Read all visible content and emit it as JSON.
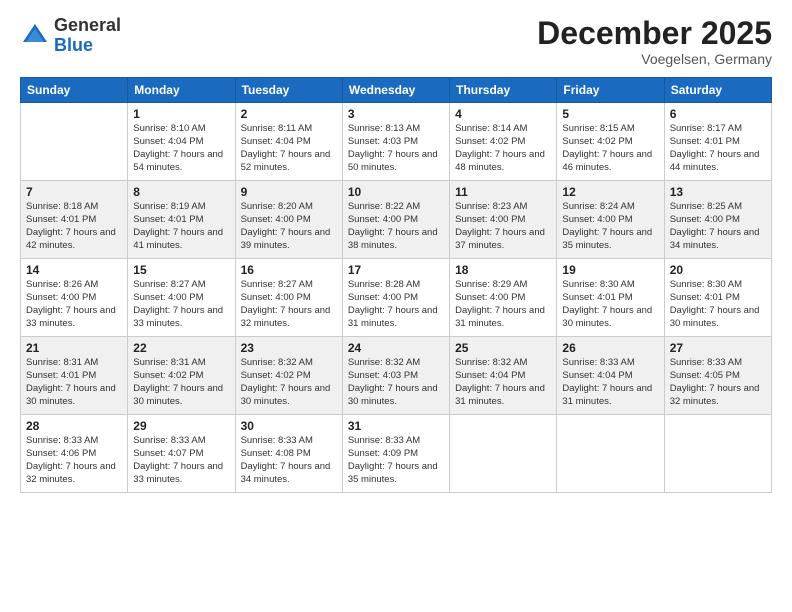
{
  "header": {
    "logo_general": "General",
    "logo_blue": "Blue",
    "month_title": "December 2025",
    "location": "Voegelsen, Germany"
  },
  "weekdays": [
    "Sunday",
    "Monday",
    "Tuesday",
    "Wednesday",
    "Thursday",
    "Friday",
    "Saturday"
  ],
  "rows": [
    {
      "shaded": false,
      "cells": [
        {
          "empty": true
        },
        {
          "day": "1",
          "sunrise": "8:10 AM",
          "sunset": "4:04 PM",
          "daylight": "7 hours and 54 minutes."
        },
        {
          "day": "2",
          "sunrise": "8:11 AM",
          "sunset": "4:04 PM",
          "daylight": "7 hours and 52 minutes."
        },
        {
          "day": "3",
          "sunrise": "8:13 AM",
          "sunset": "4:03 PM",
          "daylight": "7 hours and 50 minutes."
        },
        {
          "day": "4",
          "sunrise": "8:14 AM",
          "sunset": "4:02 PM",
          "daylight": "7 hours and 48 minutes."
        },
        {
          "day": "5",
          "sunrise": "8:15 AM",
          "sunset": "4:02 PM",
          "daylight": "7 hours and 46 minutes."
        },
        {
          "day": "6",
          "sunrise": "8:17 AM",
          "sunset": "4:01 PM",
          "daylight": "7 hours and 44 minutes."
        }
      ]
    },
    {
      "shaded": true,
      "cells": [
        {
          "day": "7",
          "sunrise": "8:18 AM",
          "sunset": "4:01 PM",
          "daylight": "7 hours and 42 minutes."
        },
        {
          "day": "8",
          "sunrise": "8:19 AM",
          "sunset": "4:01 PM",
          "daylight": "7 hours and 41 minutes."
        },
        {
          "day": "9",
          "sunrise": "8:20 AM",
          "sunset": "4:00 PM",
          "daylight": "7 hours and 39 minutes."
        },
        {
          "day": "10",
          "sunrise": "8:22 AM",
          "sunset": "4:00 PM",
          "daylight": "7 hours and 38 minutes."
        },
        {
          "day": "11",
          "sunrise": "8:23 AM",
          "sunset": "4:00 PM",
          "daylight": "7 hours and 37 minutes."
        },
        {
          "day": "12",
          "sunrise": "8:24 AM",
          "sunset": "4:00 PM",
          "daylight": "7 hours and 35 minutes."
        },
        {
          "day": "13",
          "sunrise": "8:25 AM",
          "sunset": "4:00 PM",
          "daylight": "7 hours and 34 minutes."
        }
      ]
    },
    {
      "shaded": false,
      "cells": [
        {
          "day": "14",
          "sunrise": "8:26 AM",
          "sunset": "4:00 PM",
          "daylight": "7 hours and 33 minutes."
        },
        {
          "day": "15",
          "sunrise": "8:27 AM",
          "sunset": "4:00 PM",
          "daylight": "7 hours and 33 minutes."
        },
        {
          "day": "16",
          "sunrise": "8:27 AM",
          "sunset": "4:00 PM",
          "daylight": "7 hours and 32 minutes."
        },
        {
          "day": "17",
          "sunrise": "8:28 AM",
          "sunset": "4:00 PM",
          "daylight": "7 hours and 31 minutes."
        },
        {
          "day": "18",
          "sunrise": "8:29 AM",
          "sunset": "4:00 PM",
          "daylight": "7 hours and 31 minutes."
        },
        {
          "day": "19",
          "sunrise": "8:30 AM",
          "sunset": "4:01 PM",
          "daylight": "7 hours and 30 minutes."
        },
        {
          "day": "20",
          "sunrise": "8:30 AM",
          "sunset": "4:01 PM",
          "daylight": "7 hours and 30 minutes."
        }
      ]
    },
    {
      "shaded": true,
      "cells": [
        {
          "day": "21",
          "sunrise": "8:31 AM",
          "sunset": "4:01 PM",
          "daylight": "7 hours and 30 minutes."
        },
        {
          "day": "22",
          "sunrise": "8:31 AM",
          "sunset": "4:02 PM",
          "daylight": "7 hours and 30 minutes."
        },
        {
          "day": "23",
          "sunrise": "8:32 AM",
          "sunset": "4:02 PM",
          "daylight": "7 hours and 30 minutes."
        },
        {
          "day": "24",
          "sunrise": "8:32 AM",
          "sunset": "4:03 PM",
          "daylight": "7 hours and 30 minutes."
        },
        {
          "day": "25",
          "sunrise": "8:32 AM",
          "sunset": "4:04 PM",
          "daylight": "7 hours and 31 minutes."
        },
        {
          "day": "26",
          "sunrise": "8:33 AM",
          "sunset": "4:04 PM",
          "daylight": "7 hours and 31 minutes."
        },
        {
          "day": "27",
          "sunrise": "8:33 AM",
          "sunset": "4:05 PM",
          "daylight": "7 hours and 32 minutes."
        }
      ]
    },
    {
      "shaded": false,
      "cells": [
        {
          "day": "28",
          "sunrise": "8:33 AM",
          "sunset": "4:06 PM",
          "daylight": "7 hours and 32 minutes."
        },
        {
          "day": "29",
          "sunrise": "8:33 AM",
          "sunset": "4:07 PM",
          "daylight": "7 hours and 33 minutes."
        },
        {
          "day": "30",
          "sunrise": "8:33 AM",
          "sunset": "4:08 PM",
          "daylight": "7 hours and 34 minutes."
        },
        {
          "day": "31",
          "sunrise": "8:33 AM",
          "sunset": "4:09 PM",
          "daylight": "7 hours and 35 minutes."
        },
        {
          "empty": true
        },
        {
          "empty": true
        },
        {
          "empty": true
        }
      ]
    }
  ]
}
